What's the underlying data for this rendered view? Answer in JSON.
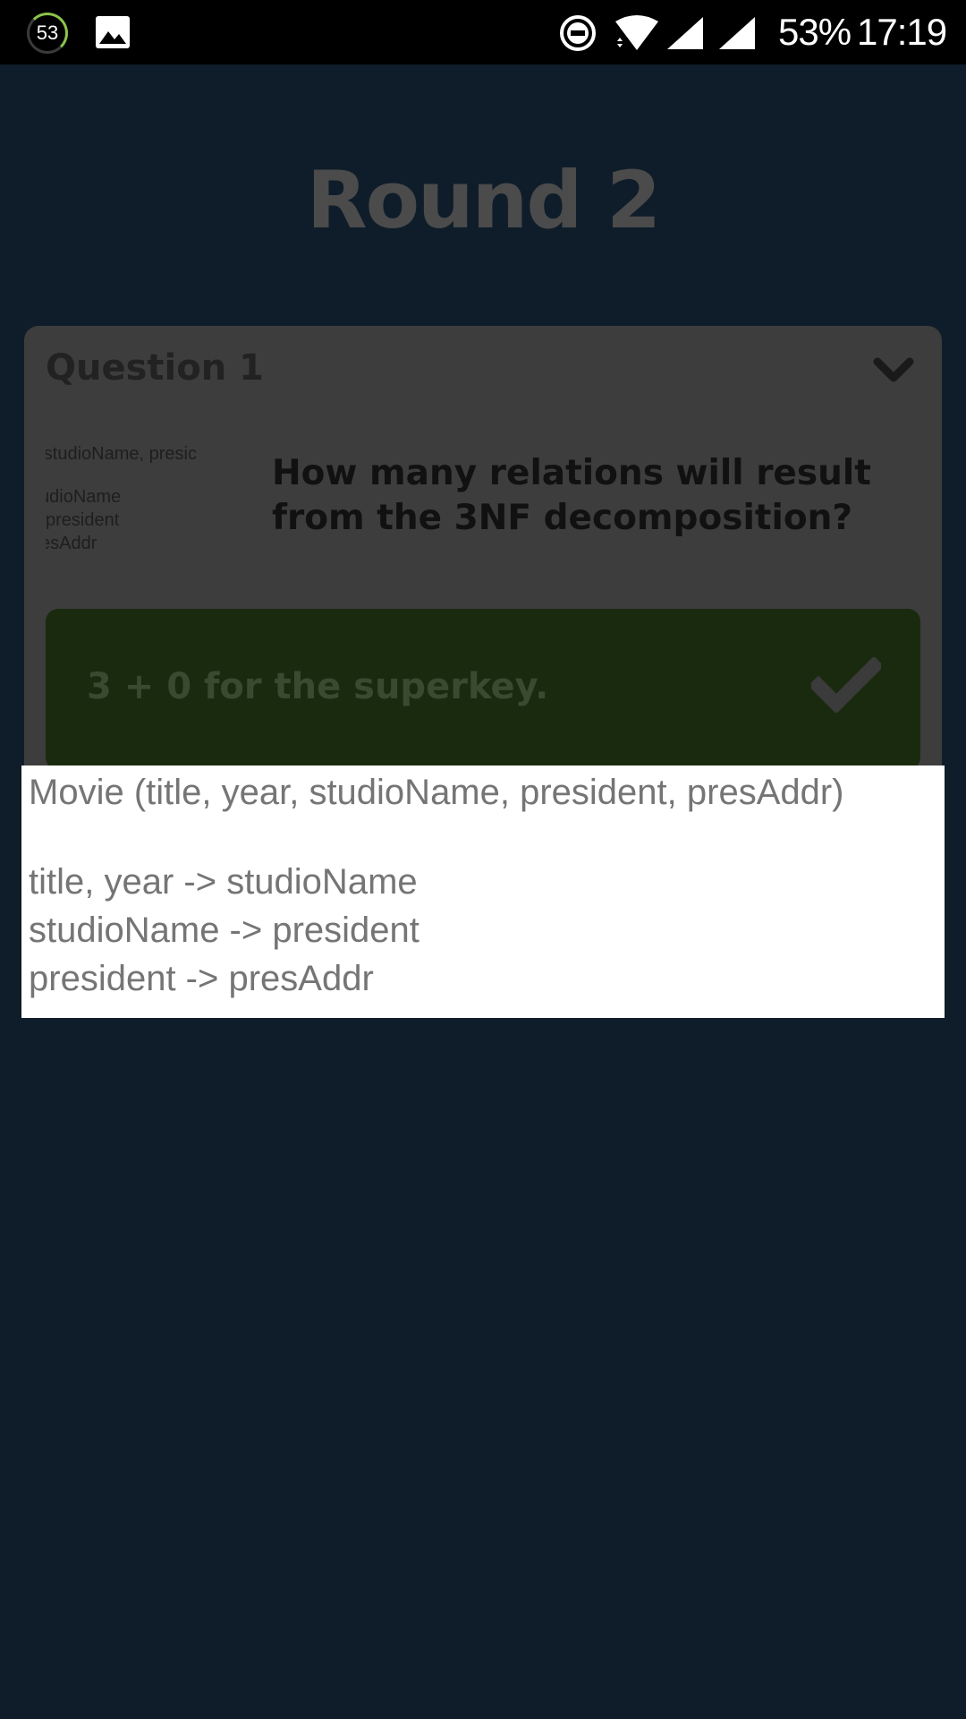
{
  "status_bar": {
    "notification_badge": "53",
    "battery": "53%",
    "time": "17:19",
    "icons": [
      "gallery-icon",
      "do-not-disturb-icon",
      "wifi-icon",
      "signal-icon",
      "signal-icon"
    ]
  },
  "screen": {
    "title": "Round 2",
    "question": {
      "header": "Question 1",
      "thumbnail_lines": [
        "ar, studioName, presic",
        "udioName",
        " president",
        "esAddr"
      ],
      "text": "How many relations will result from the 3NF decomposition?",
      "answer": "3 + 0 for the superkey."
    }
  },
  "popup": {
    "lines": [
      "Movie (title, year, studioName, president, presAddr)",
      "title, year -> studioName",
      "studioName -> president",
      "president -> presAddr"
    ]
  },
  "colors": {
    "background": "#0f1d2a",
    "card_dimmed": "#3d3d3d",
    "answer_dimmed": "#1a2a0f",
    "popup_background": "#ffffff",
    "popup_text": "#757575"
  }
}
